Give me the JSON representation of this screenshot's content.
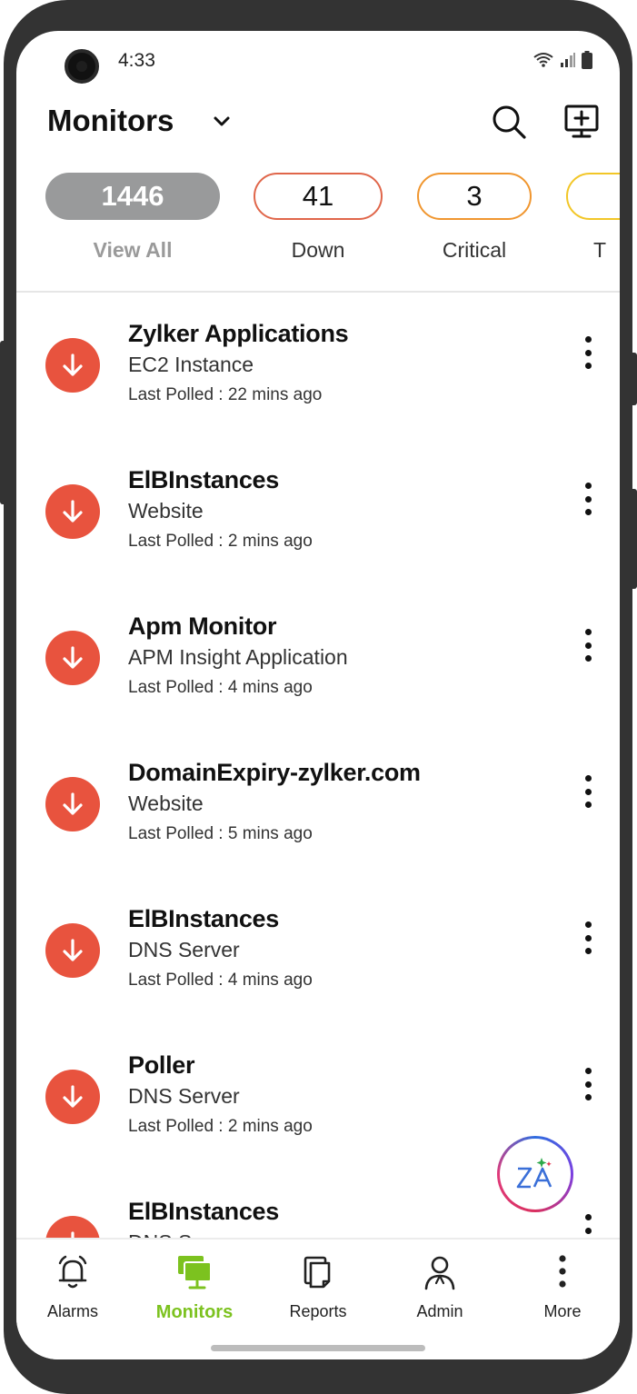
{
  "status_bar": {
    "time": "4:33"
  },
  "header": {
    "title": "Monitors"
  },
  "filters": [
    {
      "count": "1446",
      "label": "View All",
      "color": "#999a9b"
    },
    {
      "count": "41",
      "label": "Down",
      "color": "#e0664a"
    },
    {
      "count": "3",
      "label": "Critical",
      "color": "#f0962f"
    },
    {
      "count": "",
      "label": "T",
      "color": "#f2c627"
    }
  ],
  "monitors": [
    {
      "name": "Zylker Applications",
      "type": "EC2 Instance",
      "polled": "Last Polled : 22 mins ago",
      "status": "down"
    },
    {
      "name": "ElBInstances",
      "type": "Website",
      "polled": "Last Polled : 2 mins ago",
      "status": "down"
    },
    {
      "name": "Apm Monitor",
      "type": "APM Insight Application",
      "polled": "Last Polled : 4 mins ago",
      "status": "down"
    },
    {
      "name": "DomainExpiry-zylker.com",
      "type": "Website",
      "polled": "Last Polled : 5 mins ago",
      "status": "down"
    },
    {
      "name": "ElBInstances",
      "type": "DNS Server",
      "polled": "Last Polled : 4 mins ago",
      "status": "down"
    },
    {
      "name": "Poller",
      "type": "DNS Server",
      "polled": "Last Polled : 2 mins ago",
      "status": "down"
    },
    {
      "name": "ElBInstances",
      "type": "DNS Server",
      "polled": "",
      "status": "down"
    }
  ],
  "nav": {
    "alarms": "Alarms",
    "monitors": "Monitors",
    "reports": "Reports",
    "admin": "Admin",
    "more": "More"
  },
  "colors": {
    "down": "#e8533e",
    "active_nav": "#7cc21f"
  }
}
